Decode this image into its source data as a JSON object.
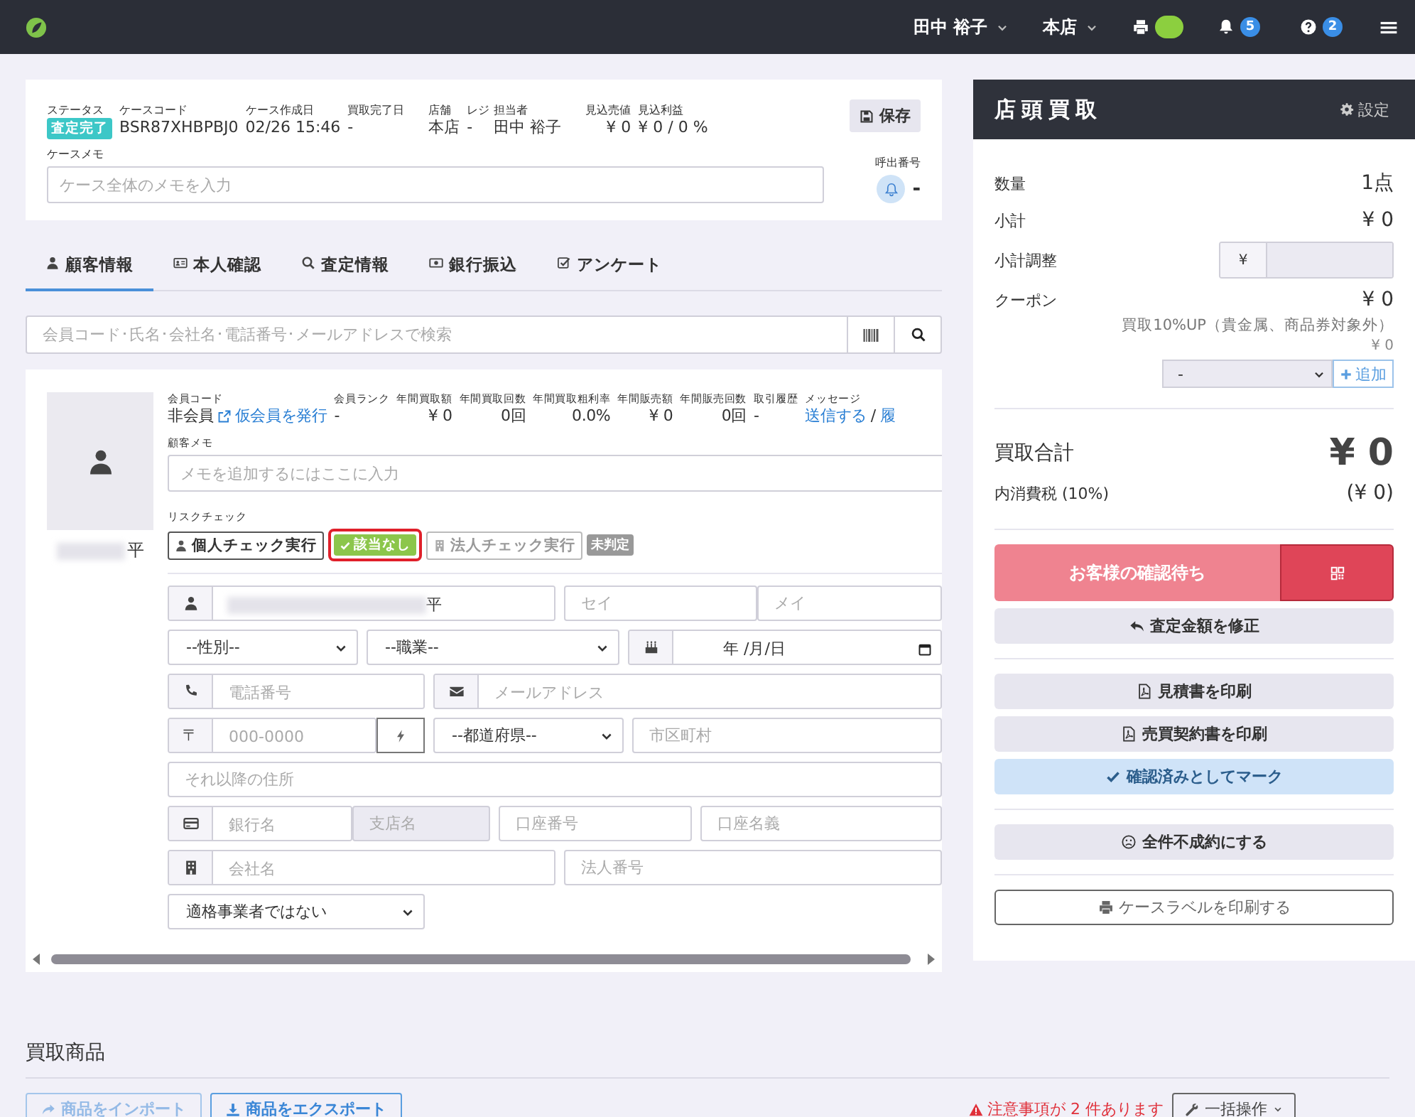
{
  "top_bar": {
    "user": "田中 裕子",
    "store": "本店",
    "printer": {
      "connected": true
    },
    "notifications": "5",
    "help": "2"
  },
  "case": {
    "fields": [
      {
        "label": "ステータス",
        "value": "査定完了",
        "kind": "badge"
      },
      {
        "label": "ケースコード",
        "value": "BSR87XHBPBJ0",
        "kind": "text"
      },
      {
        "label": "ケース作成日",
        "value": "02/26 15:46",
        "kind": "text"
      },
      {
        "label": "買取完了日",
        "value": "-",
        "kind": "text"
      },
      {
        "label": "店舗",
        "value": "本店",
        "kind": "text"
      },
      {
        "label": "レジ",
        "value": "-",
        "kind": "text"
      },
      {
        "label": "担当者",
        "value": "田中 裕子",
        "kind": "text"
      },
      {
        "label": "見込売値",
        "value": "¥ 0",
        "kind": "number"
      },
      {
        "label": "見込利益",
        "value": "¥ 0 / 0 %",
        "kind": "text"
      }
    ],
    "save": "保存",
    "memo": {
      "label": "ケースメモ",
      "placeholder": "ケース全体のメモを入力"
    },
    "call_number": {
      "label": "呼出番号",
      "value": "-"
    }
  },
  "tabs": [
    {
      "label": "顧客情報",
      "selected": true
    },
    {
      "label": "本人確認",
      "selected": false
    },
    {
      "label": "査定情報",
      "selected": false
    },
    {
      "label": "銀行振込",
      "selected": false
    },
    {
      "label": "アンケート",
      "selected": false
    }
  ],
  "customer_search": {
    "placeholder": "会員コード･氏名･会社名･電話番号･メールアドレスで検索"
  },
  "customer": {
    "name_tail": "平",
    "stats": [
      {
        "label": "会員コード",
        "value": "非会員",
        "link": "仮会員を発行",
        "kind": "member"
      },
      {
        "label": "会員ランク",
        "value": "-",
        "kind": "text"
      },
      {
        "label": "年間買取額",
        "value": "¥ 0",
        "kind": "number"
      },
      {
        "label": "年間買取回数",
        "value": "0回",
        "kind": "number"
      },
      {
        "label": "年間買取粗利率",
        "value": "0.0%",
        "kind": "number"
      },
      {
        "label": "年間販売額",
        "value": "¥ 0",
        "kind": "number"
      },
      {
        "label": "年間販売回数",
        "value": "0回",
        "kind": "number"
      },
      {
        "label": "取引履歴",
        "value": "-",
        "kind": "text"
      },
      {
        "label": "メッセージ",
        "links": [
          "送信する",
          "履"
        ],
        "separator": "/",
        "kind": "links"
      }
    ],
    "memo": {
      "label": "顧客メモ",
      "placeholder": "メモを追加するにはここに入力"
    },
    "risk_check": {
      "label": "リスクチェック",
      "individual": {
        "button": "個人チェック実行",
        "result": "該当なし",
        "highlighted": true
      },
      "corporate": {
        "button": "法人チェック実行",
        "disabled": true,
        "result": "未判定"
      }
    },
    "form": {
      "name": {
        "value": "平"
      },
      "sei": {
        "placeholder": "セイ"
      },
      "mei": {
        "placeholder": "メイ"
      },
      "gender": {
        "value": "--性別--"
      },
      "job": {
        "value": "--職業--"
      },
      "birthday": {
        "value": "年 /月/日"
      },
      "phone": {
        "placeholder": "電話番号"
      },
      "email": {
        "placeholder": "メールアドレス"
      },
      "postal_mark": "〒",
      "postal": {
        "placeholder": "000-0000"
      },
      "prefecture": {
        "value": "--都道府県--"
      },
      "city": {
        "placeholder": "市区町村"
      },
      "address": {
        "placeholder": "それ以降の住所"
      },
      "bank": {
        "placeholder": "銀行名"
      },
      "branch": {
        "placeholder": "支店名",
        "disabled": true
      },
      "account_number": {
        "placeholder": "口座番号"
      },
      "account_name": {
        "placeholder": "口座名義"
      },
      "company": {
        "placeholder": "会社名"
      },
      "corporate_number": {
        "placeholder": "法人番号"
      },
      "invoice": {
        "value": "適格事業者ではない"
      }
    }
  },
  "summary": {
    "title": "店頭買取",
    "settings": "設定",
    "quantity": {
      "label": "数量",
      "value": "1点"
    },
    "subtotal": {
      "label": "小計",
      "value": "¥ 0"
    },
    "adjustment": {
      "label": "小計調整",
      "currency": "¥"
    },
    "coupon": {
      "label": "クーポン",
      "value": "¥ 0",
      "note": "買取10%UP（貴金属、商品券対象外）",
      "note_value": "¥ 0",
      "select": "-",
      "add": "追加"
    },
    "total": {
      "label": "買取合計",
      "value": "¥ 0"
    },
    "tax": {
      "label": "内消費税 (10%)",
      "value": "(¥ 0)"
    },
    "actions": [
      {
        "kind": "danger",
        "label": "お客様の確認待ち"
      },
      {
        "kind": "secondary",
        "label": "査定金額を修正"
      },
      {
        "kind": "divider"
      },
      {
        "kind": "secondary",
        "label": "見積書を印刷"
      },
      {
        "kind": "secondary",
        "label": "売買契約書を印刷"
      },
      {
        "kind": "info",
        "label": "確認済みとしてマーク"
      },
      {
        "kind": "divider"
      },
      {
        "kind": "secondary",
        "label": "全件不成約にする"
      },
      {
        "kind": "divider"
      },
      {
        "kind": "outline",
        "label": "ケースラベルを印刷する"
      }
    ]
  },
  "items": {
    "title": "買取商品",
    "import": {
      "label": "商品をインポート",
      "disabled": true
    },
    "export": {
      "label": "商品をエクスポート",
      "disabled": false
    },
    "warning": "注意事項が 2 件あります",
    "bulk": "一括操作"
  }
}
